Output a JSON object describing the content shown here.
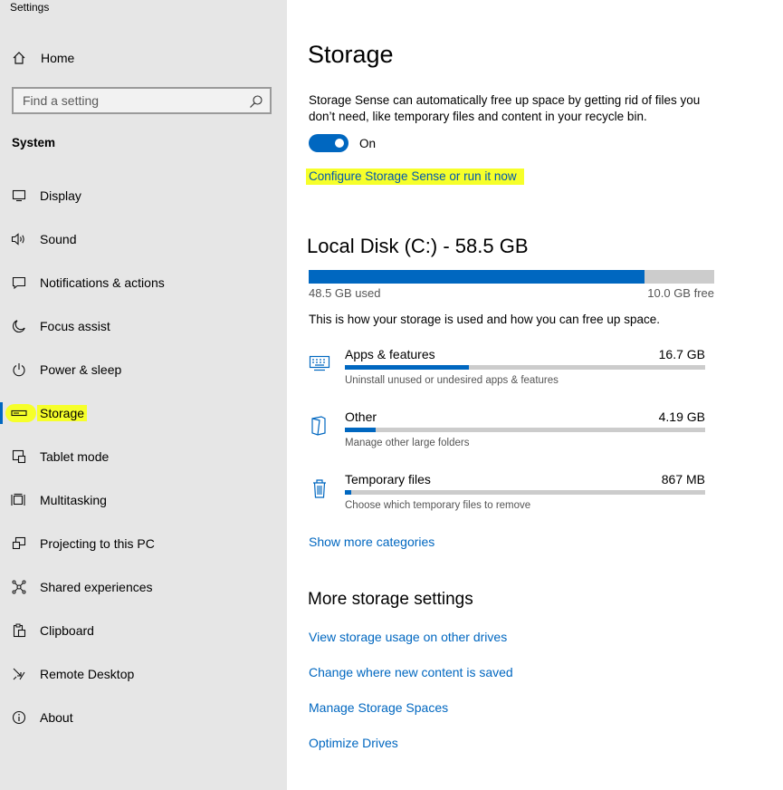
{
  "app": {
    "title": "Settings"
  },
  "sidebar": {
    "home_label": "Home",
    "search_placeholder": "Find a setting",
    "section_title": "System",
    "items": [
      {
        "label": "Display",
        "icon": "display-icon"
      },
      {
        "label": "Sound",
        "icon": "sound-icon"
      },
      {
        "label": "Notifications & actions",
        "icon": "notifications-icon"
      },
      {
        "label": "Focus assist",
        "icon": "moon-icon"
      },
      {
        "label": "Power & sleep",
        "icon": "power-icon"
      },
      {
        "label": "Storage",
        "icon": "storage-icon",
        "active": true
      },
      {
        "label": "Tablet mode",
        "icon": "tablet-mode-icon"
      },
      {
        "label": "Multitasking",
        "icon": "multitasking-icon"
      },
      {
        "label": "Projecting to this PC",
        "icon": "projecting-icon"
      },
      {
        "label": "Shared experiences",
        "icon": "shared-experiences-icon"
      },
      {
        "label": "Clipboard",
        "icon": "clipboard-icon"
      },
      {
        "label": "Remote Desktop",
        "icon": "remote-desktop-icon"
      },
      {
        "label": "About",
        "icon": "info-icon"
      }
    ]
  },
  "main": {
    "title": "Storage",
    "storage_sense": {
      "description": "Storage Sense can automatically free up space by getting rid of files you don’t need, like temporary files and content in your recycle bin.",
      "toggle_state": "On",
      "toggle_on": true,
      "configure_link": "Configure Storage Sense or run it now"
    },
    "disk": {
      "title": "Local Disk (C:) - 58.5 GB",
      "used_label": "48.5 GB used",
      "free_label": "10.0 GB free",
      "used_fraction": 0.829
    },
    "usage_intro": "This is how your storage is used and how you can free up space.",
    "categories": [
      {
        "name": "Apps & features",
        "size": "16.7 GB",
        "description": "Uninstall unused or undesired apps & features",
        "fraction": 0.344,
        "icon": "apps-features-icon"
      },
      {
        "name": "Other",
        "size": "4.19 GB",
        "description": "Manage other large folders",
        "fraction": 0.086,
        "icon": "other-folder-icon"
      },
      {
        "name": "Temporary files",
        "size": "867 MB",
        "description": "Choose which temporary files to remove",
        "fraction": 0.018,
        "icon": "trash-icon"
      }
    ],
    "show_more_link": "Show more categories",
    "more_settings": {
      "title": "More storage settings",
      "links": [
        "View storage usage on other drives",
        "Change where new content is saved",
        "Manage Storage Spaces",
        "Optimize Drives"
      ]
    }
  },
  "colors": {
    "accent": "#0067c0",
    "highlight": "#f6ff2a",
    "sidebar_bg": "#e6e6e6"
  }
}
